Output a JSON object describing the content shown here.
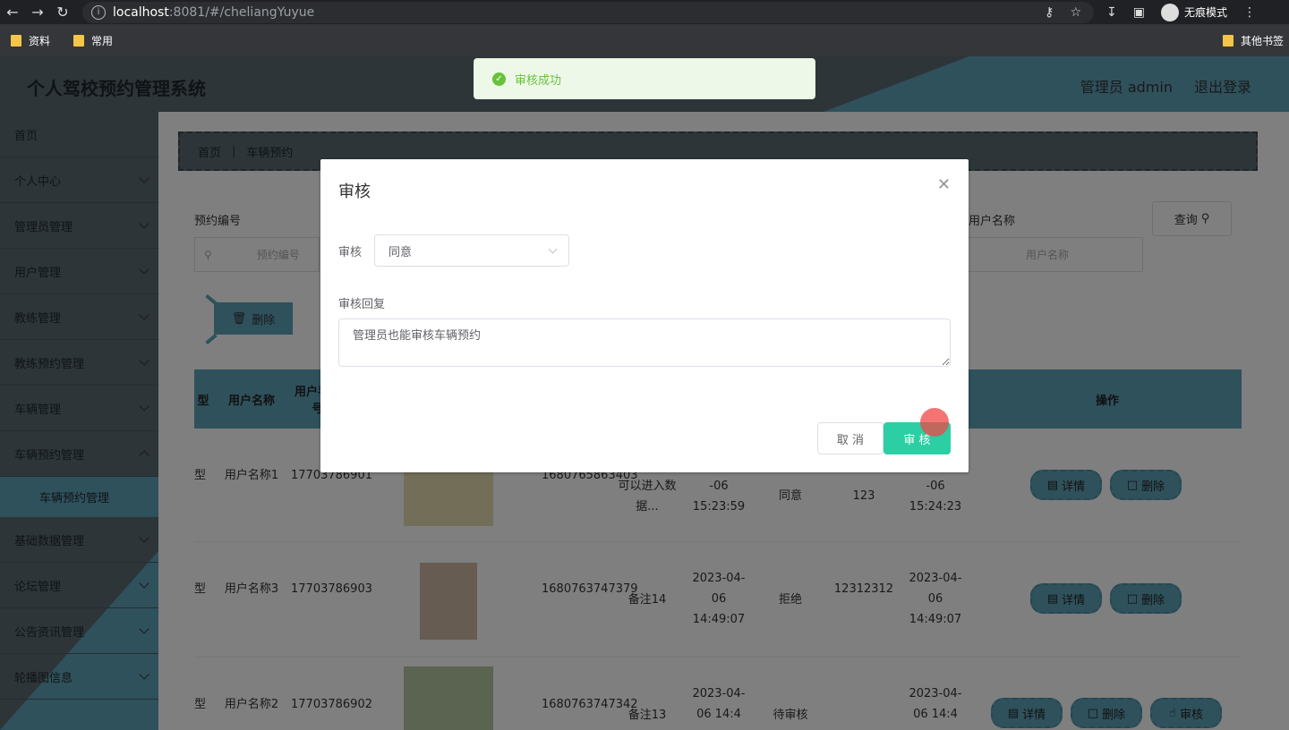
{
  "browser": {
    "url_host": "localhost",
    "url_port_path": ":8081/#/cheliangYuyue",
    "incognito_label": "无痕模式",
    "bookmarks": [
      "资料",
      "常用"
    ],
    "bookmark_other": "其他书签"
  },
  "header": {
    "title": "个人驾校预约管理系统",
    "user": "管理员 admin",
    "logout": "退出登录"
  },
  "sidebar": {
    "items": [
      {
        "label": "首页",
        "has_chevron": false
      },
      {
        "label": "个人中心",
        "has_chevron": true
      },
      {
        "label": "管理员管理",
        "has_chevron": true
      },
      {
        "label": "用户管理",
        "has_chevron": true
      },
      {
        "label": "教练管理",
        "has_chevron": true
      },
      {
        "label": "教练预约管理",
        "has_chevron": true
      },
      {
        "label": "车辆管理",
        "has_chevron": true
      },
      {
        "label": "车辆预约管理",
        "has_chevron": true
      },
      {
        "label": "基础数据管理",
        "has_chevron": true
      },
      {
        "label": "论坛管理",
        "has_chevron": true
      },
      {
        "label": "公告资讯管理",
        "has_chevron": true
      },
      {
        "label": "轮播图信息",
        "has_chevron": true
      }
    ],
    "active_sub": "车辆预约管理"
  },
  "breadcrumb": {
    "home": "首页",
    "current": "车辆预约"
  },
  "search": {
    "label1": "预约编号",
    "placeholder1": "预约编号",
    "label2": "用户名称",
    "placeholder2": "用户名称",
    "button": "查询"
  },
  "toolbar": {
    "delete_label": "删除"
  },
  "table": {
    "headers": {
      "col0": "型",
      "col1": "用户名称",
      "col2": "用户手机号",
      "ops": "操作"
    },
    "rows": [
      {
        "c0": "型",
        "name": "用户名称1",
        "phone": "17703786901",
        "code": "1680765863403",
        "note": "可以进入数据...",
        "time1": "-06 15:23:59",
        "status": "同意",
        "reply": "123",
        "time2": "-06 15:24:23"
      },
      {
        "c0": "型",
        "name": "用户名称3",
        "phone": "17703786903",
        "code": "1680763747379",
        "note": "备注14",
        "time1": "2023-04-06 14:49:07",
        "status": "拒绝",
        "reply": "12312312",
        "time2": "2023-04-06 14:49:07"
      },
      {
        "c0": "型",
        "name": "用户名称2",
        "phone": "17703786902",
        "code": "1680763747342",
        "note": "备注13",
        "time1": "2023-04-06 14:4",
        "status": "待审核",
        "reply": "",
        "time2": "2023-04-06 14:4"
      }
    ],
    "op_detail": "详情",
    "op_delete": "删除",
    "op_audit": "审核"
  },
  "toast": {
    "text": "审核成功",
    "color": "#67c23a"
  },
  "dialog": {
    "title": "审核",
    "field_label": "审核",
    "select_value": "同意",
    "reply_label": "审核回复",
    "reply_value": "管理员也能审核车辆预约",
    "cancel": "取 消",
    "confirm": "审 核"
  },
  "colors": {
    "accent": "#5ea2b8",
    "header": "#5b6b72",
    "confirm": "#2ccfa3"
  }
}
